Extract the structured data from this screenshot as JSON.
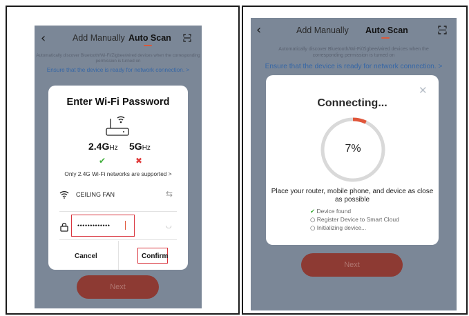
{
  "left_screen": {
    "header": {
      "tab_manual": "Add Manually",
      "tab_auto": "Auto Scan"
    },
    "hint": "Automatically discover Bluetooth/Wi-Fi/Zigbee/wired devices when the corresponding permission is turned on",
    "ensure": "Ensure that the device is ready for network connection. >",
    "dialog": {
      "title": "Enter Wi-Fi Password",
      "band_24": "2.4G",
      "band_24_unit": "Hz",
      "band_5": "5G",
      "band_5_unit": "Hz",
      "check_24": "✔",
      "cross_5": "✖",
      "supported_note": "Only 2.4G Wi-Fi networks are supported >",
      "wifi_name": "CEILING FAN",
      "switch_icon": "⇆",
      "password_value": "•••••••••••••",
      "eye_icon": "◡",
      "cancel_label": "Cancel",
      "confirm_label": "Confirm"
    },
    "next_label": "Next"
  },
  "right_screen": {
    "header": {
      "tab_manual": "Add Manually",
      "tab_auto": "Auto Scan"
    },
    "hint_line1": "Automatically discover Bluetooth/Wi-Fi/Zigbee/wired devices when the",
    "hint_line2": "corresponding permission is turned on",
    "ensure": "Ensure that the device is ready for network connection. >",
    "dialog": {
      "close_icon": "✕",
      "title": "Connecting...",
      "progress_text": "7%",
      "progress_value": 0.07,
      "advice_line1": "Place your router, mobile phone, and device as close",
      "advice_line2": "as possible",
      "steps": [
        {
          "label": "Device found",
          "done": true
        },
        {
          "label": "Register Device to Smart Cloud",
          "done": false
        },
        {
          "label": "Initializing device...",
          "done": false
        }
      ]
    },
    "next_label": "Next"
  },
  "colors": {
    "accent": "#e0563a",
    "overlay": "#7b8797",
    "link": "#3667a6",
    "next_button": "#8d3a33"
  }
}
